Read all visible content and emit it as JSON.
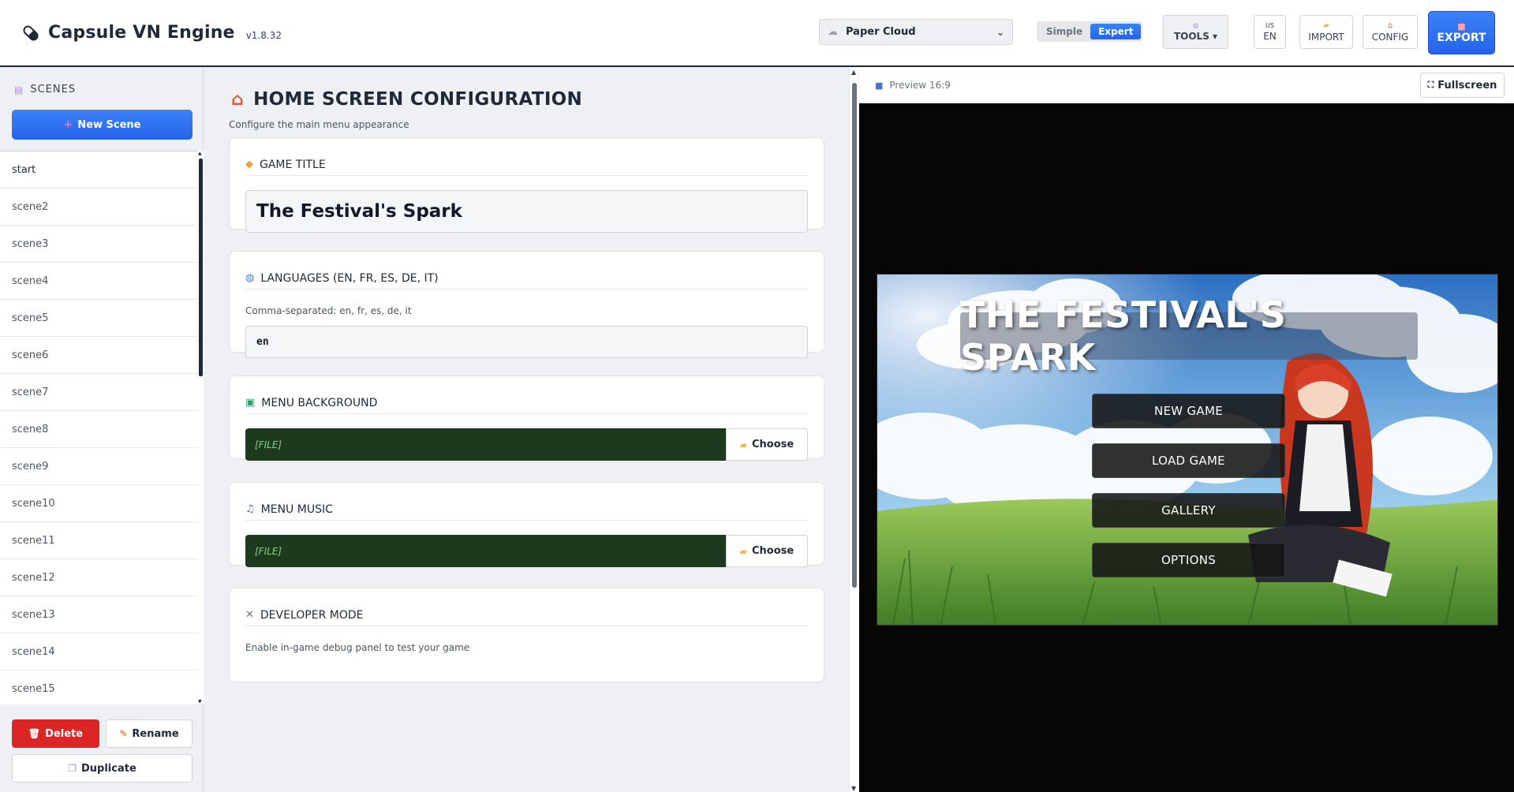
{
  "app": {
    "name": "Capsule VN Engine",
    "version": "v1.8.32"
  },
  "toolbar": {
    "theme": {
      "value": "Paper Cloud",
      "icon": "cloud-icon"
    },
    "mode": {
      "simple": "Simple",
      "expert": "Expert",
      "selected": "Expert"
    },
    "tools_label": "TOOLS",
    "lang_flag": "US",
    "lang_label": "EN",
    "import_label": "IMPORT",
    "config_label": "CONFIG",
    "export_label": "EXPORT",
    "accent_color": "#2563eb"
  },
  "sidebar": {
    "header": "SCENES",
    "new_scene_label": "New Scene",
    "scenes": [
      "start",
      "scene2",
      "scene3",
      "scene4",
      "scene5",
      "scene6",
      "scene7",
      "scene8",
      "scene9",
      "scene10",
      "scene11",
      "scene12",
      "scene13",
      "scene14",
      "scene15"
    ],
    "delete_label": "Delete",
    "rename_label": "Rename",
    "duplicate_label": "Duplicate",
    "delete_color": "#dc2626"
  },
  "main": {
    "title": "HOME SCREEN CONFIGURATION",
    "subtitle": "Configure the main menu appearance",
    "game_title": {
      "header": "GAME TITLE",
      "value": "The Festival's Spark"
    },
    "languages": {
      "header": "LANGUAGES (EN, FR, ES, DE, IT)",
      "hint": "Comma-separated: en, fr, es, de, it",
      "value": "en"
    },
    "menu_background": {
      "header": "MENU BACKGROUND",
      "file": "[FILE]",
      "choose_label": "Choose"
    },
    "menu_music": {
      "header": "MENU MUSIC",
      "file": "[FILE]",
      "choose_label": "Choose"
    },
    "developer_mode": {
      "header": "DEVELOPER MODE",
      "hint": "Enable in-game debug panel to test your game"
    }
  },
  "preview": {
    "label": "Preview 16:9",
    "fullscreen_label": "Fullscreen",
    "game_title": "THE FESTIVAL'S SPARK",
    "menu": [
      "NEW GAME",
      "LOAD GAME",
      "GALLERY",
      "OPTIONS"
    ]
  }
}
